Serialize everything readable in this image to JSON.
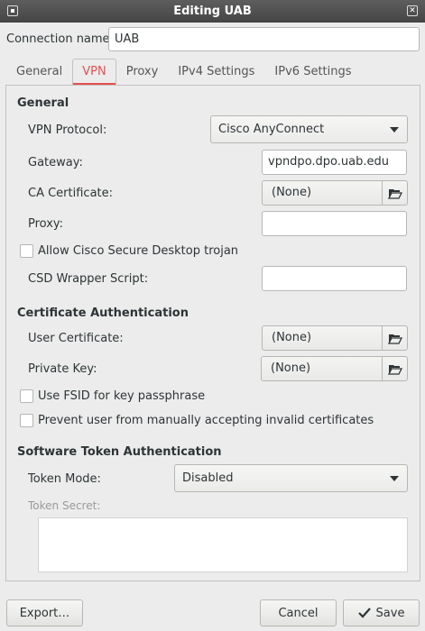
{
  "window": {
    "title": "Editing UAB"
  },
  "connection": {
    "label": "Connection name",
    "value": "UAB"
  },
  "tabs": [
    {
      "label": "General"
    },
    {
      "label": "VPN"
    },
    {
      "label": "Proxy"
    },
    {
      "label": "IPv4 Settings"
    },
    {
      "label": "IPv6 Settings"
    }
  ],
  "general": {
    "heading": "General",
    "protocol_label": "VPN Protocol:",
    "protocol_value": "Cisco AnyConnect",
    "gateway_label": "Gateway:",
    "gateway_value": "vpndpo.dpo.uab.edu",
    "ca_label": "CA Certificate:",
    "ca_value": "(None)",
    "proxy_label": "Proxy:",
    "proxy_value": "",
    "csd_trojan_label": "Allow Cisco Secure Desktop trojan",
    "csd_wrapper_label": "CSD Wrapper Script:",
    "csd_wrapper_value": ""
  },
  "cert_auth": {
    "heading": "Certificate Authentication",
    "user_cert_label": "User Certificate:",
    "user_cert_value": "(None)",
    "private_key_label": "Private Key:",
    "private_key_value": "(None)",
    "fsid_label": "Use FSID for key passphrase",
    "prevent_label": "Prevent user from manually accepting invalid certificates"
  },
  "token_auth": {
    "heading": "Software Token Authentication",
    "mode_label": "Token Mode:",
    "mode_value": "Disabled",
    "secret_label": "Token Secret:"
  },
  "buttons": {
    "export": "Export…",
    "cancel": "Cancel",
    "save": "Save"
  }
}
